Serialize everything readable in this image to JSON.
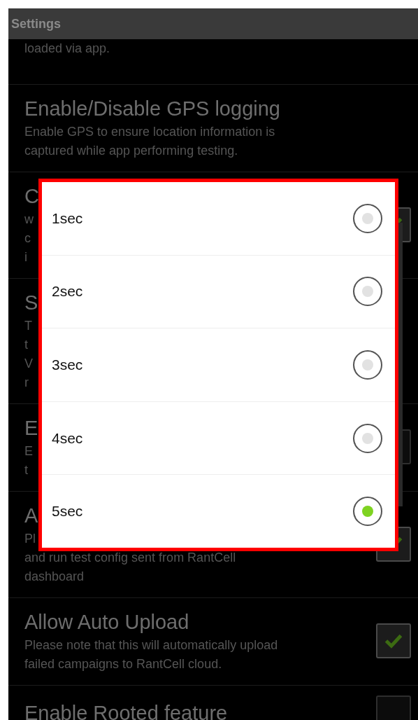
{
  "header": {
    "title": "Settings"
  },
  "settings": [
    {
      "lines": [
        "loaded via app."
      ]
    },
    {
      "title": "Enable/Disable GPS logging",
      "lines": [
        "Enable GPS to ensure location information is",
        "captured while app performing testing."
      ]
    },
    {
      "title": "C",
      "lines": [
        "w",
        "c",
        "i"
      ],
      "kind": "checkbox",
      "checked": true
    },
    {
      "title": "S",
      "lines": [
        "T",
        "t",
        "V",
        "r"
      ]
    },
    {
      "title": "E",
      "lines": [
        "E",
        "t"
      ],
      "kind": "checkbox",
      "checked": false
    },
    {
      "title": "A",
      "lines": [
        "Pl",
        "and run test config sent from RantCell",
        "dashboard"
      ],
      "kind": "checkbox",
      "checked": true
    },
    {
      "title": "Allow Auto Upload",
      "lines": [
        "Please note that this will automatically upload",
        "failed campaigns to RantCell cloud."
      ],
      "kind": "checkbox",
      "checked": true
    },
    {
      "title": "Enable Rooted feature",
      "kind": "checkbox",
      "checked": false
    }
  ],
  "dialog": {
    "options": [
      {
        "label": "1sec",
        "selected": false
      },
      {
        "label": "2sec",
        "selected": false
      },
      {
        "label": "3sec",
        "selected": false
      },
      {
        "label": "4sec",
        "selected": false
      },
      {
        "label": "5sec",
        "selected": true
      }
    ]
  }
}
